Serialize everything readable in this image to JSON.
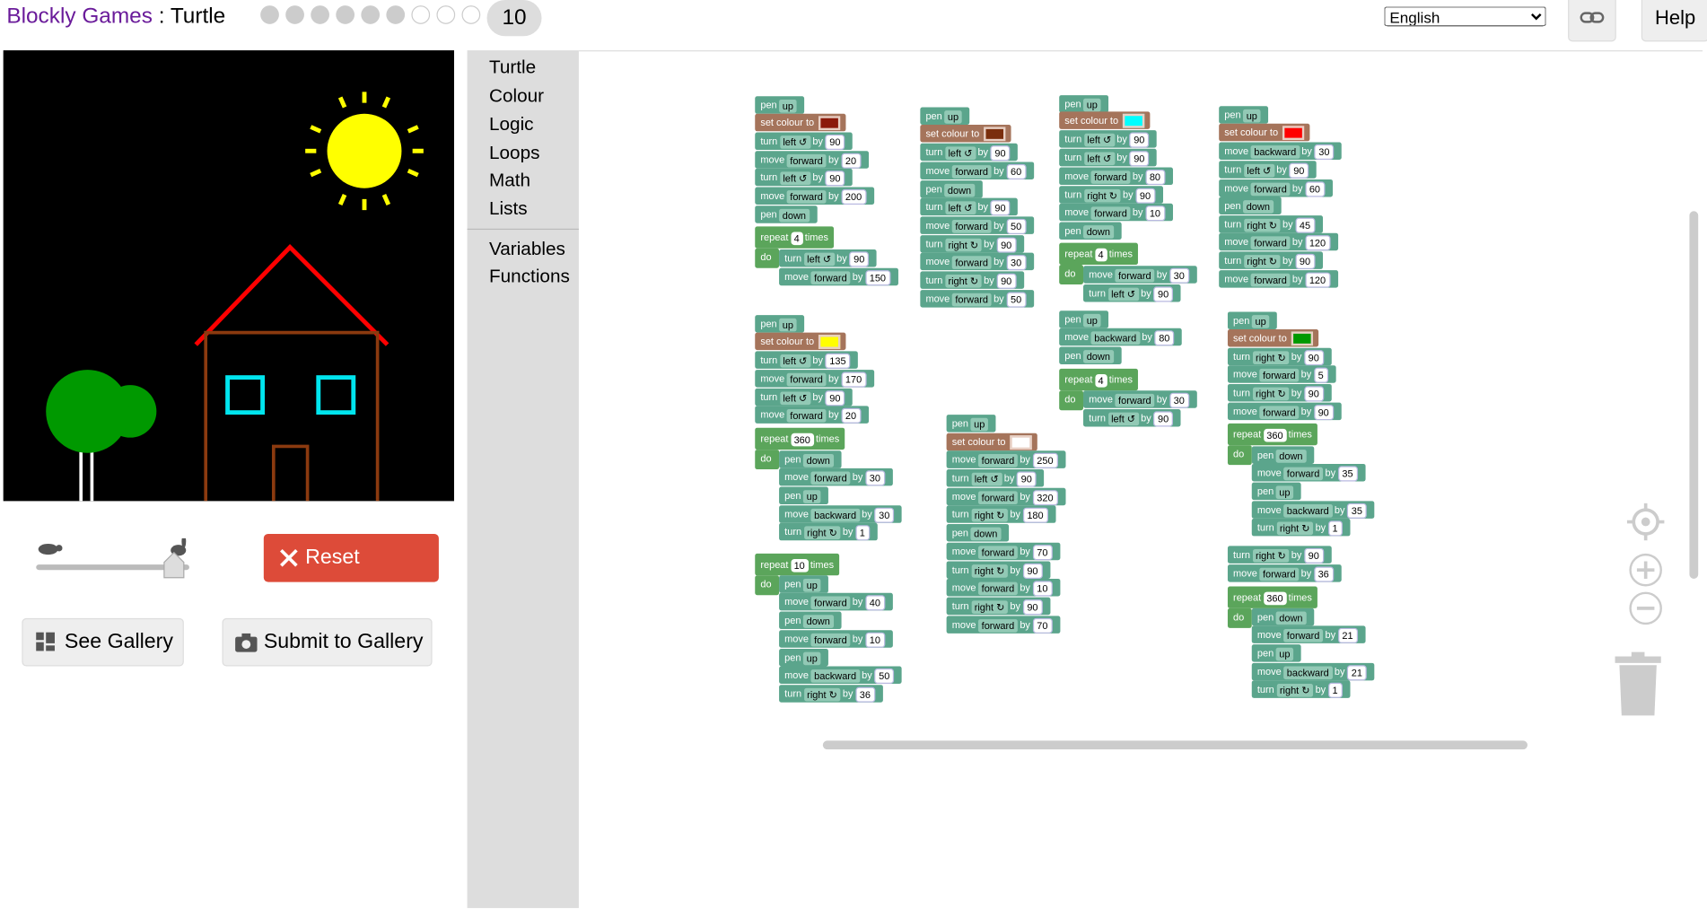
{
  "header": {
    "brand": "Blockly Games",
    "separator": " : ",
    "game": "Turtle",
    "level": "10",
    "language": "English",
    "help": "Help"
  },
  "icons": {
    "link": "link-icon",
    "turtle": "turtle-icon",
    "rabbit": "rabbit-icon",
    "reset": "x-icon",
    "gallery": "grid-icon",
    "camera": "camera-icon",
    "recenter": "target-icon",
    "zoom_in": "zoom-in-icon",
    "zoom_out": "zoom-out-icon",
    "trash": "trash-icon"
  },
  "controls": {
    "reset": "Reset",
    "see_gallery": "See Gallery",
    "submit_gallery": "Submit to Gallery",
    "speed": 0.9
  },
  "toolbox": [
    "Turtle",
    "Colour",
    "Logic",
    "Loops",
    "Math",
    "Lists",
    "Variables",
    "Functions"
  ],
  "colors": {
    "turtle_block": "#5ba58c",
    "colour_block": "#a5745b",
    "loop_block": "#5ba55b",
    "reset_button": "#dd4b39",
    "brand": "#6a1b9a",
    "sun": "#ffff00",
    "roof": "#ff0000",
    "walls": "#8b3a0f",
    "windows": "#00e5ee",
    "tree": "#009900"
  },
  "words": {
    "pen": "pen",
    "up": "up",
    "down": "down",
    "set_colour": "set colour to",
    "turn": "turn",
    "left": "left ↺",
    "right": "right ↻",
    "move": "move",
    "forward": "forward",
    "backward": "backward",
    "by": "by",
    "repeat": "repeat",
    "times": "times",
    "do": "do"
  }
}
